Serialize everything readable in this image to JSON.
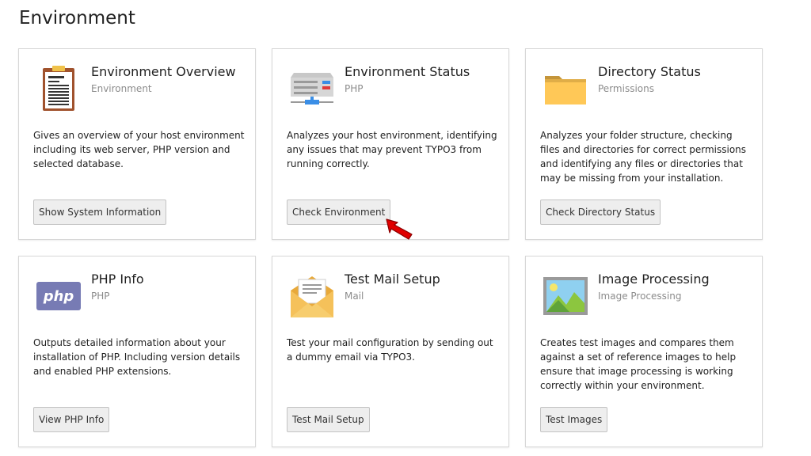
{
  "page": {
    "title": "Environment"
  },
  "cards": [
    {
      "title": "Environment Overview",
      "subtitle": "Environment",
      "description": "Gives an overview of your host environment including its web server, PHP version and selected database.",
      "button": "Show System Information",
      "icon": "clipboard-icon"
    },
    {
      "title": "Environment Status",
      "subtitle": "PHP",
      "description": "Analyzes your host environment, identifying any issues that may prevent TYPO3 from running correctly.",
      "button": "Check Environment",
      "icon": "server-icon"
    },
    {
      "title": "Directory Status",
      "subtitle": "Permissions",
      "description": "Analyzes your folder structure, checking files and directories for correct permissions and identifying any files or directories that may be missing from your installation.",
      "button": "Check Directory Status",
      "icon": "folder-icon"
    },
    {
      "title": "PHP Info",
      "subtitle": "PHP",
      "description": "Outputs detailed information about your installation of PHP. Including version details and enabled PHP extensions.",
      "button": "View PHP Info",
      "icon": "php-logo-icon",
      "logo_text": "php"
    },
    {
      "title": "Test Mail Setup",
      "subtitle": "Mail",
      "description": "Test your mail configuration by sending out a dummy email via TYPO3.",
      "button": "Test Mail Setup",
      "icon": "envelope-icon"
    },
    {
      "title": "Image Processing",
      "subtitle": "Image Processing",
      "description": "Creates test images and compares them against a set of reference images to help ensure that image processing is working correctly within your environment.",
      "button": "Test Images",
      "icon": "image-icon"
    }
  ],
  "colors": {
    "pointer_red": "#e00000",
    "php_purple": "#777bb4",
    "folder_yellow": "#ffc857"
  }
}
